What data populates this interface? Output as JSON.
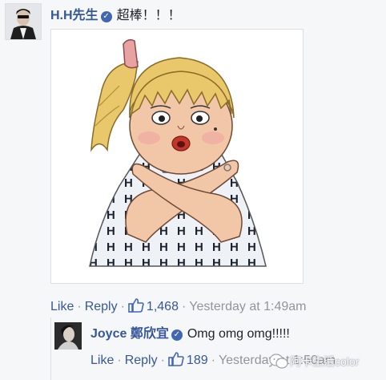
{
  "comment": {
    "author": "H.H先生",
    "text": "超棒！！！",
    "actions": {
      "like": "Like",
      "reply": "Reply",
      "like_count": "1,468",
      "timestamp": "Yesterday at 1:49am"
    }
  },
  "reply": {
    "author": "Joyce 鄭欣宜",
    "text": "Omg omg omg!!!!!",
    "actions": {
      "like": "Like",
      "reply": "Reply",
      "like_count": "189",
      "timestamp": "Yesterday at 1:50am"
    }
  },
  "watermark": {
    "text": "阿卡生活color"
  },
  "colors": {
    "link": "#365899",
    "meta": "#90949c",
    "verified": "#4267b2",
    "background": "#f6f7f9"
  }
}
